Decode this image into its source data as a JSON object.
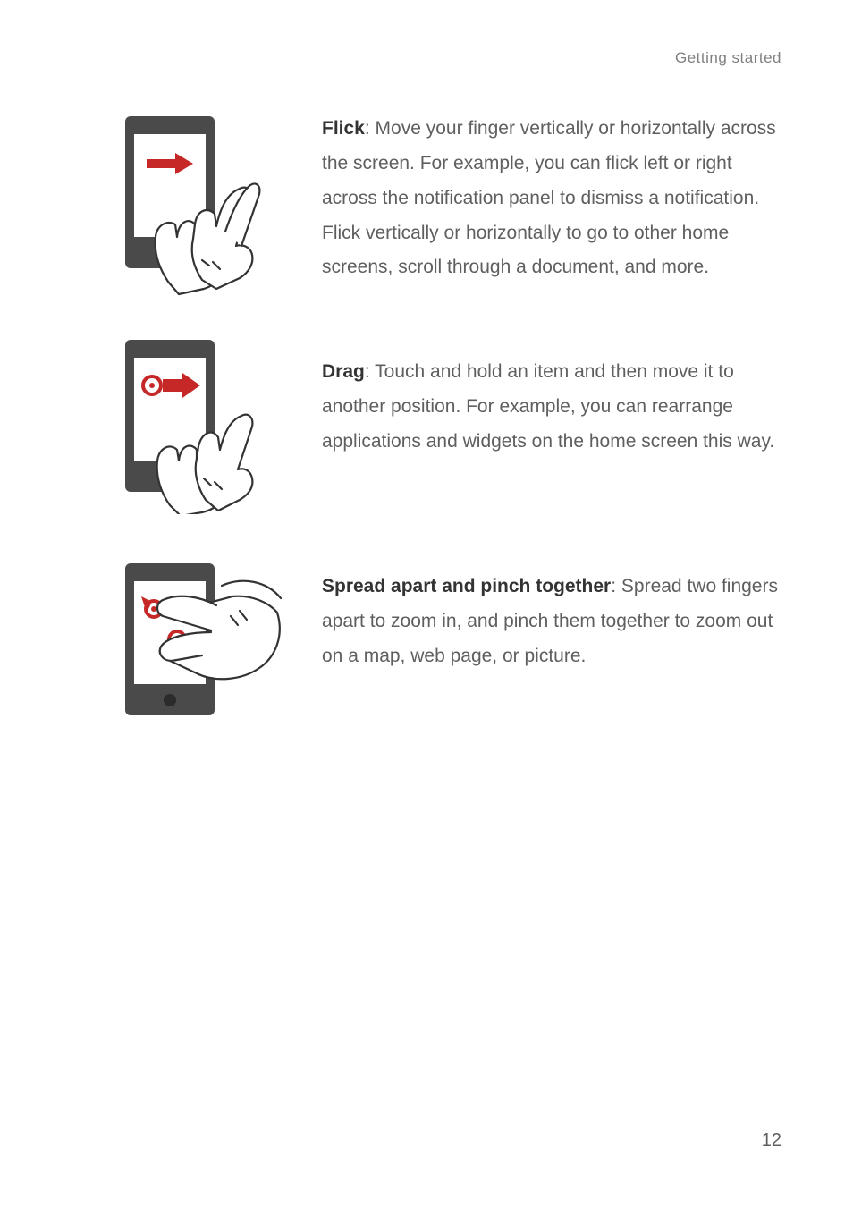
{
  "header": {
    "section_title": "Getting started"
  },
  "page_number": "12",
  "entries": [
    {
      "title": "Flick",
      "body": ": Move your finger vertically or horizontally across the screen. For example, you can flick left or right across the notification panel to dismiss a notification. Flick vertically or horizontally to go to other home screens, scroll through a document, and more."
    },
    {
      "title": "Drag",
      "body": ": Touch and hold an item and then move it to another position. For example, you can rearrange applications and widgets on the home screen this way."
    },
    {
      "title": "Spread apart and pinch together",
      "body": ": Spread two fingers apart to zoom in, and pinch them together to zoom out on a map, web page, or picture."
    }
  ]
}
